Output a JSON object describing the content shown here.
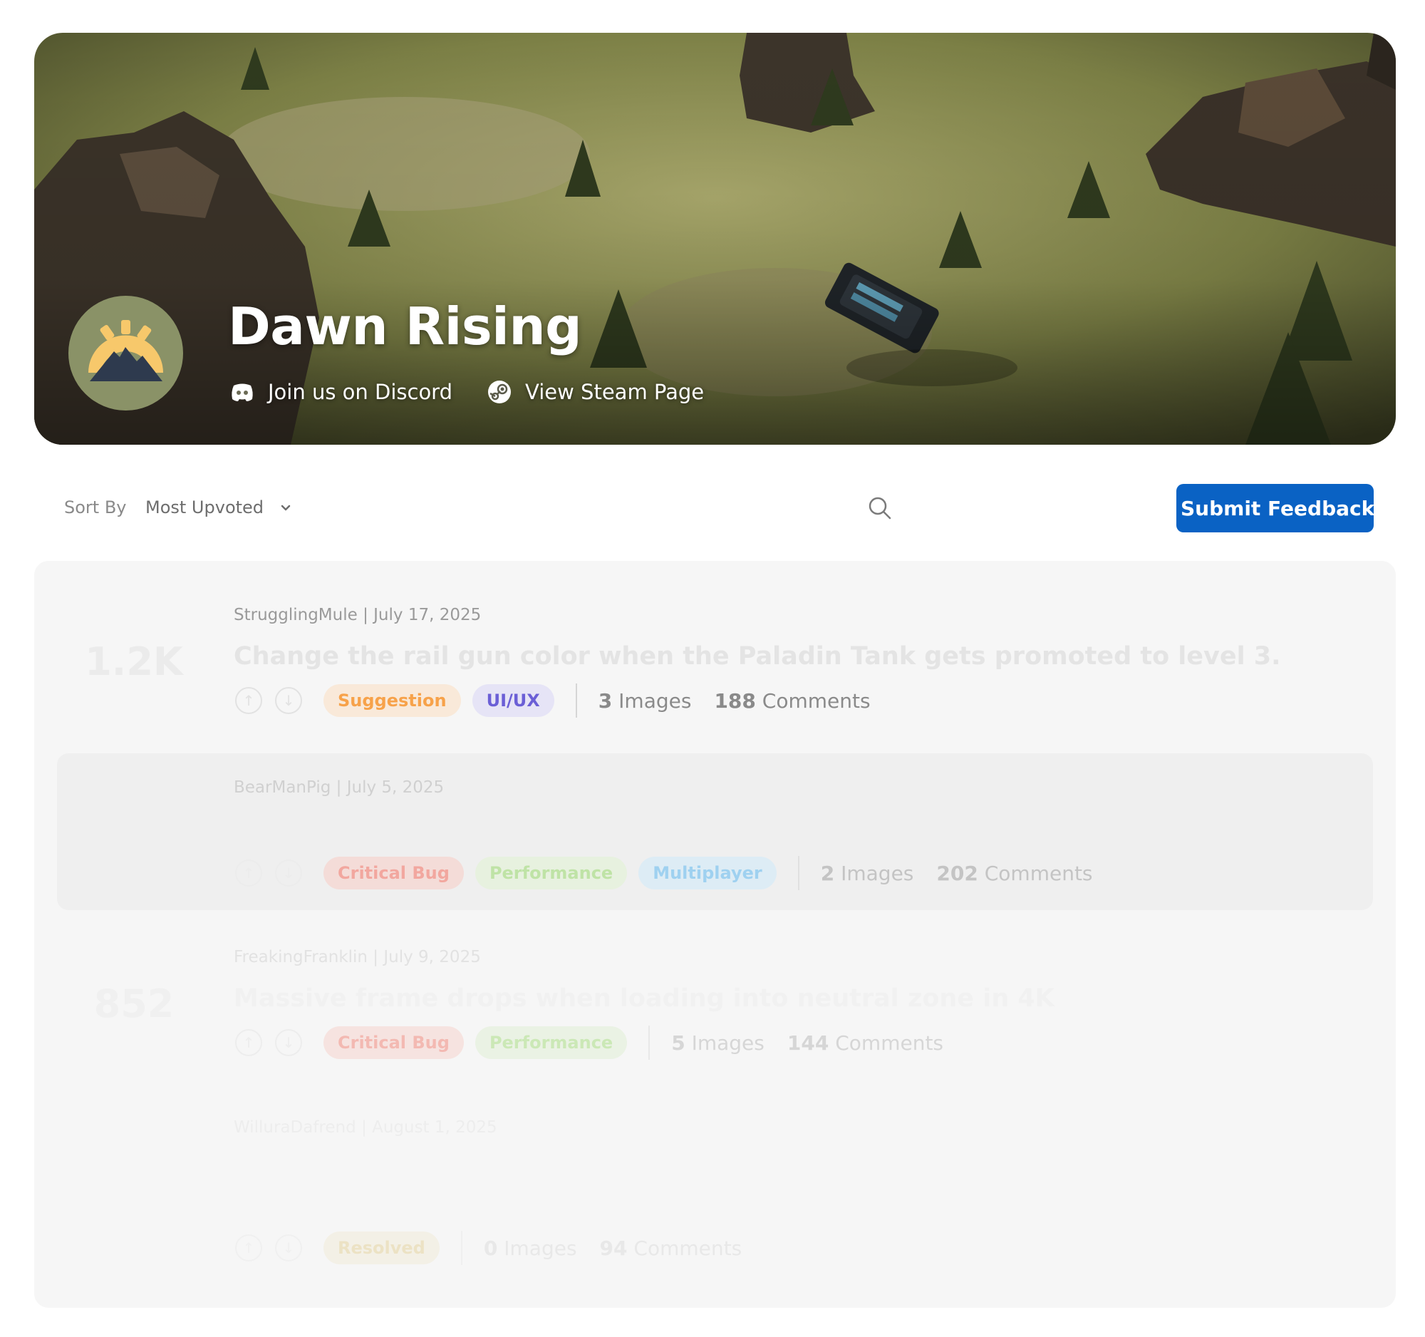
{
  "hero": {
    "title": "Dawn Rising",
    "discord_label": "Join us on Discord",
    "steam_label": "View Steam Page"
  },
  "toolbar": {
    "sort_label": "Sort By",
    "sort_value": "Most Upvoted",
    "submit_label": "Submit Feedback"
  },
  "posts": [
    {
      "score": "1.2K",
      "meta": "StrugglingMule | July 17, 2025",
      "title": "Change the rail gun color when the Paladin Tank gets promoted to level 3.",
      "tags": [
        "Suggestion",
        "UI/UX"
      ],
      "images_count": "3",
      "images_label": "Images",
      "comments_count": "188",
      "comments_label": "Comments"
    },
    {
      "score": "",
      "meta": "BearManPig | July 5, 2025",
      "title": "",
      "tags": [
        "Critical Bug",
        "Performance",
        "Multiplayer"
      ],
      "images_count": "2",
      "images_label": "Images",
      "comments_count": "202",
      "comments_label": "Comments"
    },
    {
      "score": "852",
      "meta": "FreakingFranklin | July 9, 2025",
      "title": "Massive frame drops when loading into neutral zone in 4K",
      "tags": [
        "Critical Bug",
        "Performance"
      ],
      "images_count": "5",
      "images_label": "Images",
      "comments_count": "144",
      "comments_label": "Comments"
    },
    {
      "score": "",
      "meta": "WilluraDafrend | August 1, 2025",
      "title": "",
      "tags": [
        "Resolved"
      ],
      "images_count": "0",
      "images_label": "Images",
      "comments_count": "94",
      "comments_label": "Comments"
    }
  ],
  "icons": {
    "discord": "discord-icon",
    "steam": "steam-icon",
    "search": "search-icon",
    "chevron": "chevron-down-icon",
    "upvote": "arrow-up-icon",
    "downvote": "arrow-down-icon"
  },
  "colors": {
    "brand_button": "#0a62c4",
    "logo_bg": "#8a9267",
    "logo_sun": "#f7c86b",
    "logo_mountain": "#2e3a4e",
    "tag_suggestion": "#f7a24a",
    "tag_uiux": "#6b5fd6",
    "tag_critical_bug": "#e85a4f",
    "tag_performance": "#6cc04a",
    "tag_multiplayer": "#4aaee8",
    "tag_resolved": "#d8b24a"
  }
}
